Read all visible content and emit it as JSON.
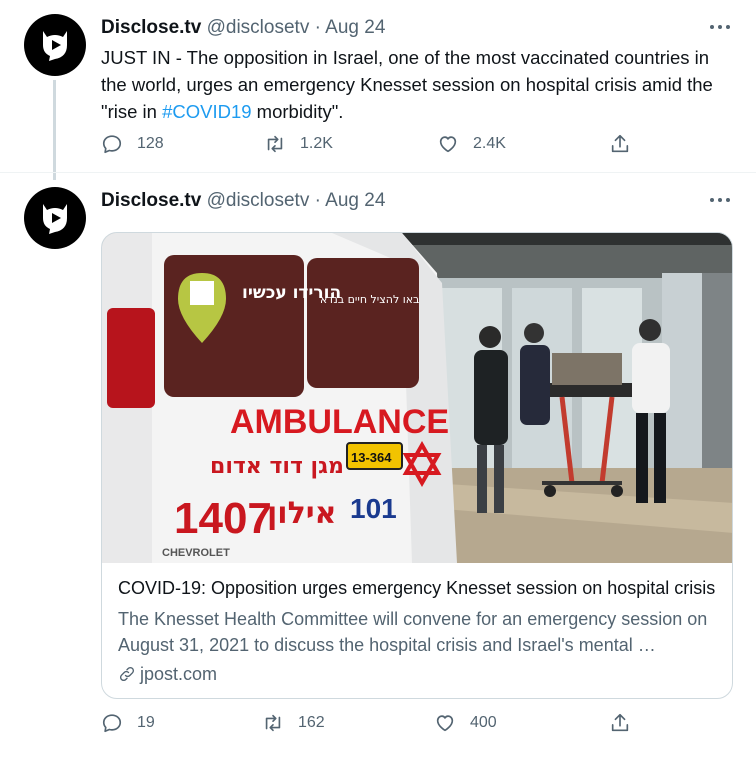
{
  "tweets": [
    {
      "name": "Disclose.tv",
      "handle": "@disclosetv",
      "separator": "·",
      "date": "Aug 24",
      "text_before": "JUST IN - The opposition in Israel, one of the most vaccinated countries in the world, urges an emergency Knesset session on hospital crisis amid the \"rise in ",
      "hashtag": "#COVID19",
      "text_after": " morbidity\".",
      "replies": "128",
      "retweets": "1.2K",
      "likes": "2.4K"
    },
    {
      "name": "Disclose.tv",
      "handle": "@disclosetv",
      "separator": "·",
      "date": "Aug 24",
      "replies": "19",
      "retweets": "162",
      "likes": "400",
      "card": {
        "title": "COVID-19: Opposition urges emergency Knesset session on hospital crisis",
        "description": "The Knesset Health Committee will convene for an emergency session on August 31, 2021 to discuss the hospital crisis and Israel's mental …",
        "domain": "jpost.com",
        "image_text": {
          "ambulance": "AMBULANCE",
          "hebrew_main": "מגן דוד אדום",
          "hebrew_city": "אילון",
          "number": "1407",
          "unit": "101",
          "plate": "13-364",
          "sign_download": "הורידו עכשיו",
          "sign_save": "באו להציל חיים בנדא",
          "brand": "CHEVROLET"
        }
      }
    }
  ],
  "colors": {
    "link": "#1d9bf0",
    "secondary": "#536471",
    "border": "#cfd9de",
    "mda_red": "#d71920"
  }
}
